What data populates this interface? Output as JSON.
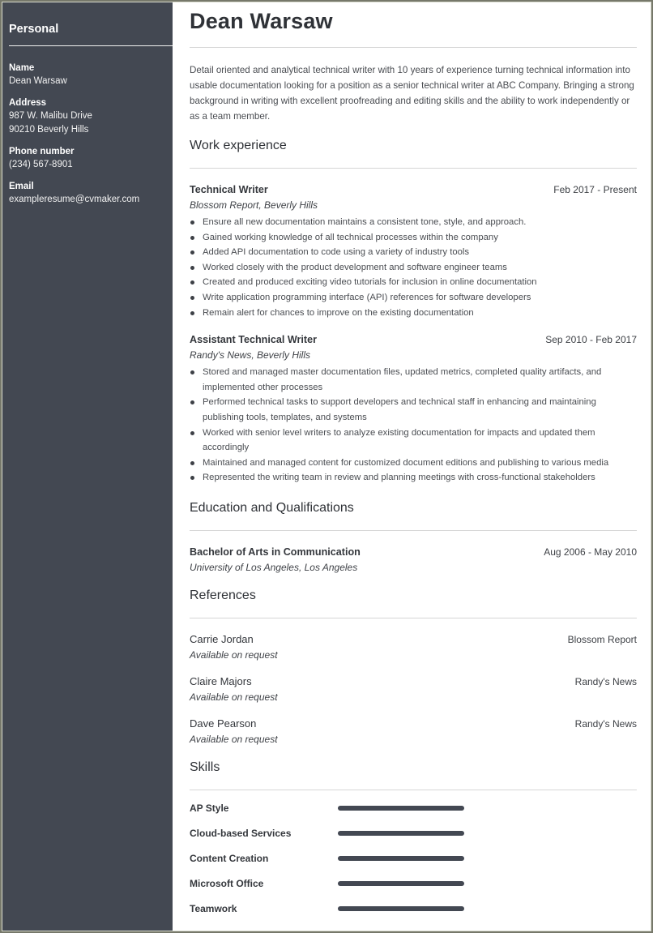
{
  "sidebar": {
    "heading": "Personal",
    "fields": [
      {
        "label": "Name",
        "lines": [
          "Dean Warsaw"
        ]
      },
      {
        "label": "Address",
        "lines": [
          "987 W. Malibu Drive",
          "90210 Beverly Hills"
        ]
      },
      {
        "label": "Phone number",
        "lines": [
          "(234) 567-8901"
        ]
      },
      {
        "label": "Email",
        "lines": [
          "exampleresume@cvmaker.com"
        ]
      }
    ]
  },
  "header": {
    "name": "Dean Warsaw",
    "summary": "Detail oriented and analytical technical writer with 10 years of experience turning technical information into usable documentation looking for a position as a senior technical writer at ABC Company. Bringing a strong background in writing with excellent proofreading and editing skills and the ability to work independently or as a team member."
  },
  "work": {
    "title": "Work experience",
    "jobs": [
      {
        "title": "Technical Writer",
        "dates": "Feb 2017 - Present",
        "company": "Blossom Report, Beverly Hills",
        "bullets": [
          "Ensure all new documentation maintains a consistent tone, style, and approach.",
          "Gained working knowledge of all technical processes within the company",
          "Added API documentation to code using a variety of industry tools",
          "Worked closely with the product development and software engineer teams",
          "Created and produced exciting video tutorials for inclusion in online documentation",
          "Write application programming interface (API) references for software developers",
          "Remain alert for chances to improve on the existing documentation"
        ]
      },
      {
        "title": "Assistant Technical Writer",
        "dates": "Sep 2010 - Feb 2017",
        "company": "Randy's News, Beverly Hills",
        "bullets": [
          "Stored and managed master documentation files, updated metrics, completed quality artifacts, and implemented other processes",
          "Performed technical tasks to support developers and technical staff in enhancing and maintaining publishing tools, templates, and systems",
          "Worked with senior level writers to analyze existing documentation for impacts and updated them accordingly",
          "Maintained and managed content for customized document editions and publishing to various media",
          "Represented the writing team in review and planning meetings with cross-functional stakeholders"
        ]
      }
    ]
  },
  "education": {
    "title": "Education and Qualifications",
    "items": [
      {
        "degree": "Bachelor of Arts in Communication",
        "dates": "Aug 2006 - May 2010",
        "school": "University of Los Angeles, Los Angeles"
      }
    ]
  },
  "references": {
    "title": "References",
    "items": [
      {
        "name": "Carrie Jordan",
        "org": "Blossom Report",
        "note": "Available on request"
      },
      {
        "name": "Claire Majors",
        "org": "Randy's News",
        "note": "Available on request"
      },
      {
        "name": "Dave Pearson",
        "org": "Randy's News",
        "note": "Available on request"
      }
    ]
  },
  "skills": {
    "title": "Skills",
    "items": [
      {
        "name": "AP Style",
        "level": 1.0
      },
      {
        "name": "Cloud-based Services",
        "level": 1.0
      },
      {
        "name": "Content Creation",
        "level": 1.0
      },
      {
        "name": "Microsoft Office",
        "level": 1.0
      },
      {
        "name": "Teamwork",
        "level": 1.0
      }
    ]
  },
  "colors": {
    "sidebar_bg": "#434852",
    "skill_bar": "#434852",
    "frame": "#76786a"
  }
}
